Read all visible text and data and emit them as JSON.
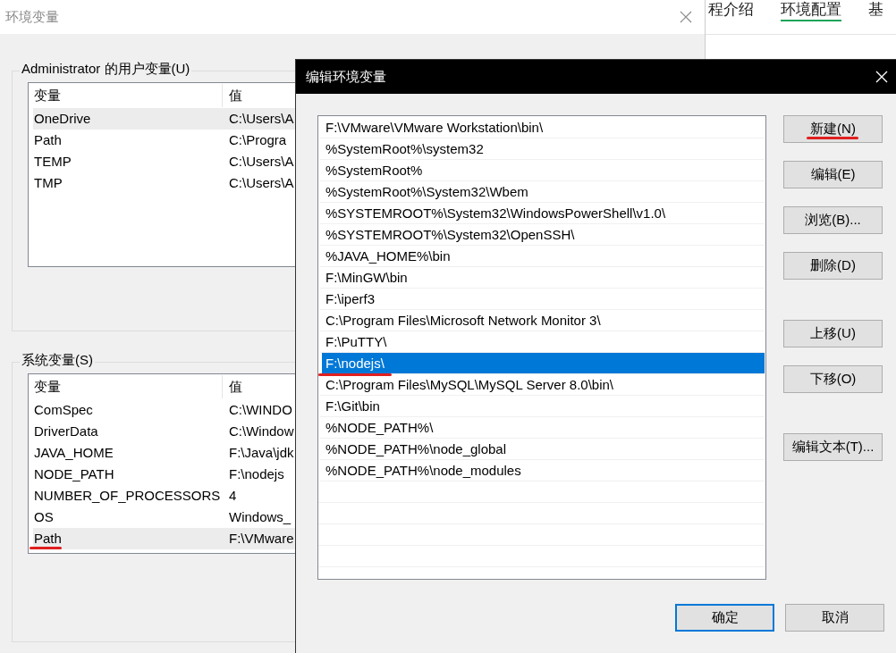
{
  "background_page": {
    "tabs": [
      {
        "label": "程介绍",
        "selected": false
      },
      {
        "label": "环境配置",
        "selected": true
      },
      {
        "label": "基",
        "selected": false
      }
    ]
  },
  "env_window": {
    "title": "环境变量",
    "groups": [
      {
        "title": "Administrator 的用户变量(U)",
        "columns": [
          "变量",
          "值"
        ],
        "rows": [
          {
            "name": "OneDrive",
            "value": "C:\\Users\\A",
            "selected": true,
            "marked": false
          },
          {
            "name": "Path",
            "value": "C:\\Progra",
            "selected": false,
            "marked": false
          },
          {
            "name": "TEMP",
            "value": "C:\\Users\\A",
            "selected": false,
            "marked": false
          },
          {
            "name": "TMP",
            "value": "C:\\Users\\A",
            "selected": false,
            "marked": false
          }
        ]
      },
      {
        "title": "系统变量(S)",
        "columns": [
          "变量",
          "值"
        ],
        "rows": [
          {
            "name": "ComSpec",
            "value": "C:\\WINDO",
            "selected": false,
            "marked": false
          },
          {
            "name": "DriverData",
            "value": "C:\\Window",
            "selected": false,
            "marked": false
          },
          {
            "name": "JAVA_HOME",
            "value": "F:\\Java\\jdk",
            "selected": false,
            "marked": false
          },
          {
            "name": "NODE_PATH",
            "value": "F:\\nodejs",
            "selected": false,
            "marked": false
          },
          {
            "name": "NUMBER_OF_PROCESSORS",
            "value": "4",
            "selected": false,
            "marked": false
          },
          {
            "name": "OS",
            "value": "Windows_",
            "selected": false,
            "marked": false
          },
          {
            "name": "Path",
            "value": "F:\\VMware",
            "selected": true,
            "marked": true
          }
        ]
      }
    ]
  },
  "edit_dialog": {
    "title": "编辑环境变量",
    "entries": [
      {
        "text": "F:\\VMware\\VMware Workstation\\bin\\",
        "selected": false,
        "marked": false
      },
      {
        "text": "%SystemRoot%\\system32",
        "selected": false,
        "marked": false
      },
      {
        "text": "%SystemRoot%",
        "selected": false,
        "marked": false
      },
      {
        "text": "%SystemRoot%\\System32\\Wbem",
        "selected": false,
        "marked": false
      },
      {
        "text": "%SYSTEMROOT%\\System32\\WindowsPowerShell\\v1.0\\",
        "selected": false,
        "marked": false
      },
      {
        "text": "%SYSTEMROOT%\\System32\\OpenSSH\\",
        "selected": false,
        "marked": false
      },
      {
        "text": "%JAVA_HOME%\\bin",
        "selected": false,
        "marked": false
      },
      {
        "text": "F:\\MinGW\\bin",
        "selected": false,
        "marked": false
      },
      {
        "text": "F:\\iperf3",
        "selected": false,
        "marked": false
      },
      {
        "text": "C:\\Program Files\\Microsoft Network Monitor 3\\",
        "selected": false,
        "marked": false
      },
      {
        "text": "F:\\PuTTY\\",
        "selected": false,
        "marked": false
      },
      {
        "text": "F:\\nodejs\\",
        "selected": true,
        "marked": true
      },
      {
        "text": "C:\\Program Files\\MySQL\\MySQL Server 8.0\\bin\\",
        "selected": false,
        "marked": false
      },
      {
        "text": "F:\\Git\\bin",
        "selected": false,
        "marked": false
      },
      {
        "text": "%NODE_PATH%\\",
        "selected": false,
        "marked": false
      },
      {
        "text": "%NODE_PATH%\\node_global",
        "selected": false,
        "marked": false
      },
      {
        "text": "%NODE_PATH%\\node_modules",
        "selected": false,
        "marked": false
      }
    ],
    "side_button_groups": [
      [
        {
          "label": "新建(N)",
          "marked": true
        },
        {
          "label": "编辑(E)",
          "marked": false
        },
        {
          "label": "浏览(B)...",
          "marked": false
        },
        {
          "label": "删除(D)",
          "marked": false
        }
      ],
      [
        {
          "label": "上移(U)",
          "marked": false
        },
        {
          "label": "下移(O)",
          "marked": false
        }
      ],
      [
        {
          "label": "编辑文本(T)...",
          "marked": false
        }
      ]
    ],
    "ok": "确定",
    "cancel": "取消"
  }
}
